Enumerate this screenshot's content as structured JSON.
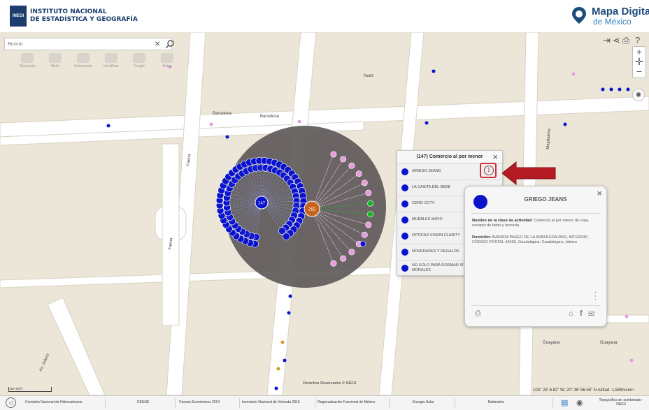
{
  "header": {
    "logo_abbr": "INEGI",
    "org_line1": "INSTITUTO NACIONAL",
    "org_line2": "DE ESTADÍSTICA Y GEOGRAFÍA",
    "app_title": "Mapa Digital",
    "app_subtitle": "de México"
  },
  "search": {
    "placeholder": "Buscar",
    "clear": "×"
  },
  "tools": [
    "Búsqueda",
    "Medir",
    "Información",
    "Identificar",
    "Google",
    "Rutas"
  ],
  "streets": [
    "Barcelona",
    "Barcelona",
    "Nuez",
    "Faena",
    "Faena",
    "Magdalena",
    "Guayana",
    "Guayana",
    "Av. Juárez"
  ],
  "cluster": {
    "center_label": "147",
    "orange_label": "262"
  },
  "list_panel": {
    "title": "(147) Comercio al por menor",
    "close": "×",
    "items": [
      "GRIEGO JEANS",
      "LA CASITA DEL BEBE",
      "CERO CCTV",
      "MUEBLES MAYO",
      "ÓPTICAS VISIÓN CLARITY",
      "NOVEDADES Y REGALOS",
      "NO SOLO PARA DORMAR SITAN MORALES"
    ]
  },
  "info_button": {
    "glyph": "i"
  },
  "detail": {
    "name": "GRIEGO JEANS",
    "close": "×",
    "activity_label": "Nombre de la clase de actividad:",
    "activity_value": "Comercio al por menor de ropa, excepto de bebé y lencería",
    "address_label": "Domicilio:",
    "address_value": "AVENIDA PASEO DE LA ARBOLEDA 2500, INTERIOR , CÓDIGO POSTAL 44530, Guadalajara, Guadalajara, Jalisco"
  },
  "map_footer": {
    "copyright": "Derechos Reservados © INEGI",
    "coords": "103° 23' 6.82\" W; 20° 36' 56.55\" N   Altitud: 1,589msnm",
    "scale": "15m   50 ft"
  },
  "footer_tabs": [
    "Comisión Nacional de Hidrocarburos",
    "DENUE",
    "Censos Económicos 2014",
    "Inventario Nacional de Vivienda 2016",
    "Regionalización Funcional de México",
    "Energía Solar",
    "Batimetría",
    "Topográfico sin sombreado - INEGI"
  ],
  "colors": {
    "marker_blue": "#0b12cc",
    "marker_pink": "#e79cdf",
    "marker_green": "#18b52a",
    "cluster_gray": "#5e5a5a",
    "cluster_orange": "#c7651f",
    "arrow_red": "#b51a24",
    "brand_blue": "#1d4b7c"
  }
}
